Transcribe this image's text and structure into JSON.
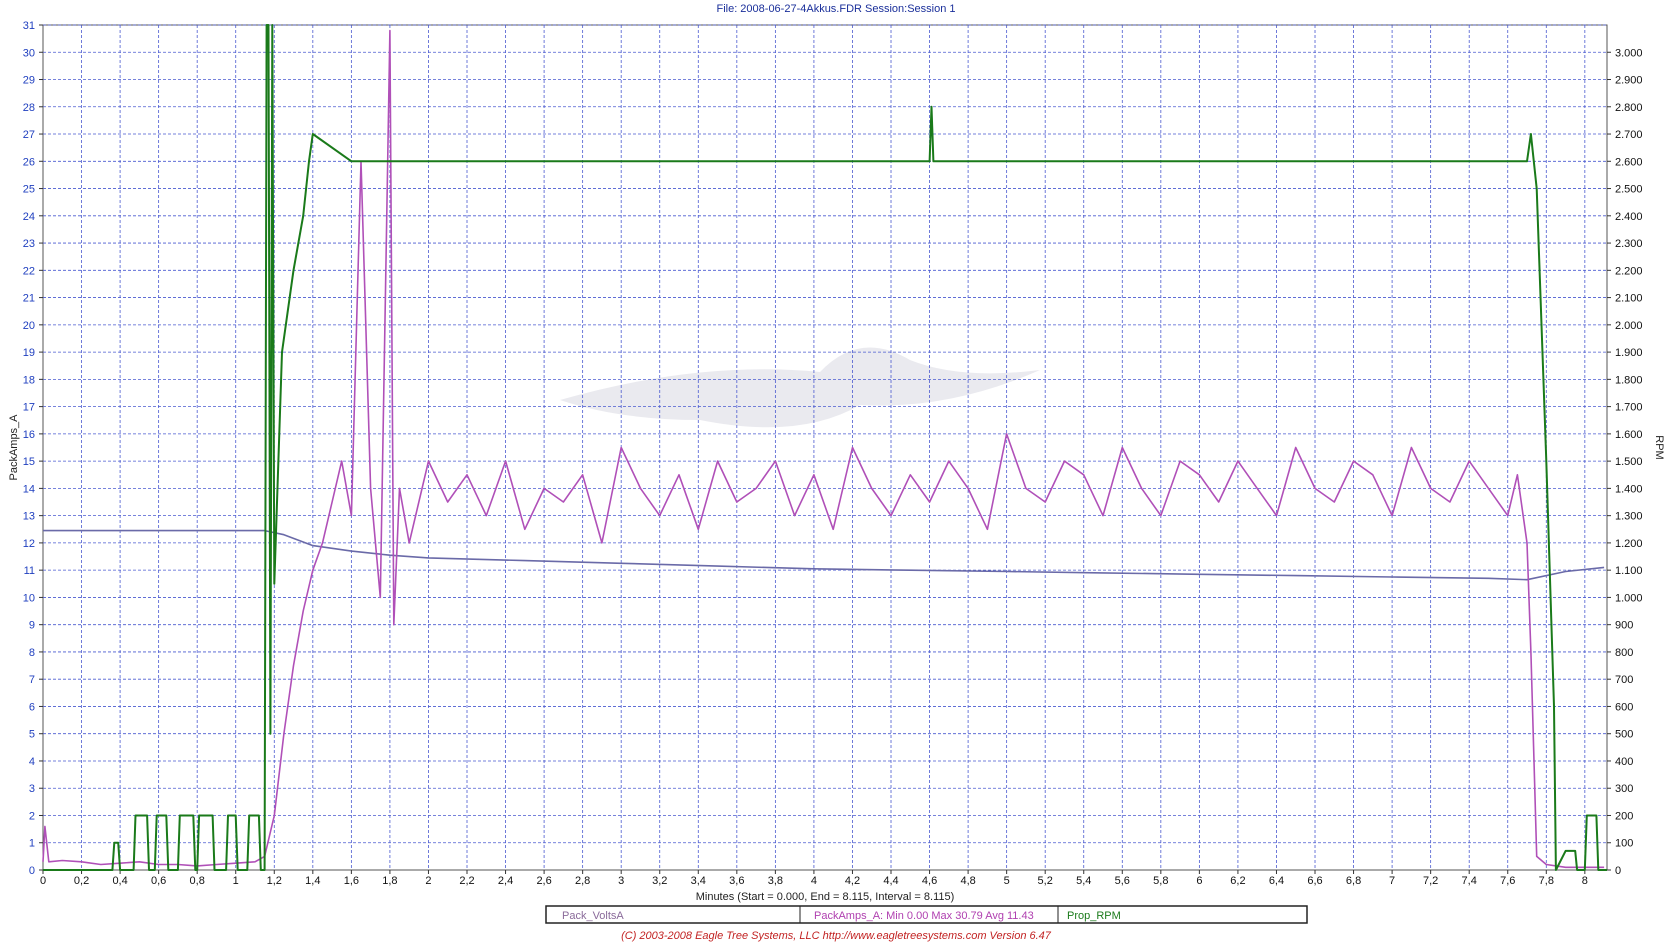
{
  "window": {
    "title": "File: 2008-06-27-4Akkus.FDR   Session:Session 1",
    "footer": "(C) 2003-2008 Eagle Tree Systems, LLC      http://www.eagletreesystems.com      Version 6.47"
  },
  "chart_data": {
    "type": "line",
    "title": "File: 2008-06-27-4Akkus.FDR   Session:Session 1",
    "xlabel": "Minutes (Start = 0.000,  End = 8.115,  Interval = 8.115)",
    "ylabel": "PackAmps_A",
    "ylabel_right": "RPM",
    "xlim": [
      0,
      8.115
    ],
    "ylim": [
      0,
      31
    ],
    "ylim_right": [
      0,
      3100
    ],
    "grid": true,
    "x_ticks": [
      "0",
      "0,2",
      "0,4",
      "0,6",
      "0,8",
      "1",
      "1,2",
      "1,4",
      "1,6",
      "1,8",
      "2",
      "2,2",
      "2,4",
      "2,6",
      "2,8",
      "3",
      "3,2",
      "3,4",
      "3,6",
      "3,8",
      "4",
      "4,2",
      "4,4",
      "4,6",
      "4,8",
      "5",
      "5,2",
      "5,4",
      "5,6",
      "5,8",
      "6",
      "6,2",
      "6,4",
      "6,6",
      "6,8",
      "7",
      "7,2",
      "7,4",
      "7,6",
      "7,8",
      "8"
    ],
    "y_ticks_left": [
      "0",
      "1",
      "2",
      "3",
      "4",
      "5",
      "6",
      "7",
      "8",
      "9",
      "10",
      "11",
      "12",
      "13",
      "14",
      "15",
      "16",
      "17",
      "18",
      "19",
      "20",
      "21",
      "22",
      "23",
      "24",
      "25",
      "26",
      "27",
      "28",
      "29",
      "30",
      "31"
    ],
    "y_ticks_right": [
      "0",
      "100",
      "200",
      "300",
      "400",
      "500",
      "600",
      "700",
      "800",
      "900",
      "1.000",
      "1.100",
      "1.200",
      "1.300",
      "1.400",
      "1.500",
      "1.600",
      "1.700",
      "1.800",
      "1.900",
      "2.000",
      "2.100",
      "2.200",
      "2.300",
      "2.400",
      "2.500",
      "2.600",
      "2.700",
      "2.800",
      "2.900",
      "3.000"
    ],
    "legend": [
      {
        "text": "Pack_VoltsA",
        "color": "#8a6a9a"
      },
      {
        "text": "PackAmps_A:  Min 0.00   Max 30.79   Avg 11.43",
        "color": "#b040b0"
      },
      {
        "text": "Prop_RPM",
        "color": "#1a7a1a"
      }
    ],
    "series": [
      {
        "name": "Pack_VoltsA",
        "axis": "left",
        "color": "#6a6aa8",
        "x": [
          0,
          0.5,
          1.0,
          1.15,
          1.25,
          1.4,
          1.6,
          1.8,
          2.0,
          2.5,
          3.0,
          3.5,
          4.0,
          4.5,
          5.0,
          5.5,
          6.0,
          6.5,
          7.0,
          7.5,
          7.7,
          7.9,
          8.1
        ],
        "values": [
          12.45,
          12.45,
          12.45,
          12.45,
          12.3,
          11.9,
          11.7,
          11.55,
          11.45,
          11.35,
          11.25,
          11.15,
          11.05,
          11.0,
          10.95,
          10.9,
          10.85,
          10.8,
          10.75,
          10.7,
          10.65,
          10.95,
          11.1
        ]
      },
      {
        "name": "PackAmps_A",
        "axis": "left",
        "color": "#b050b8",
        "x": [
          0,
          0.01,
          0.03,
          0.1,
          0.2,
          0.3,
          0.4,
          0.5,
          0.6,
          0.7,
          0.8,
          0.9,
          1.0,
          1.1,
          1.15,
          1.2,
          1.25,
          1.3,
          1.35,
          1.4,
          1.45,
          1.5,
          1.55,
          1.6,
          1.65,
          1.7,
          1.75,
          1.8,
          1.82,
          1.85,
          1.9,
          2.0,
          2.1,
          2.2,
          2.3,
          2.4,
          2.5,
          2.6,
          2.7,
          2.8,
          2.9,
          3.0,
          3.1,
          3.2,
          3.3,
          3.4,
          3.5,
          3.6,
          3.7,
          3.8,
          3.9,
          4.0,
          4.1,
          4.2,
          4.3,
          4.4,
          4.5,
          4.6,
          4.7,
          4.8,
          4.9,
          5.0,
          5.1,
          5.2,
          5.3,
          5.4,
          5.5,
          5.6,
          5.7,
          5.8,
          5.9,
          6.0,
          6.1,
          6.2,
          6.3,
          6.4,
          6.5,
          6.6,
          6.7,
          6.8,
          6.9,
          7.0,
          7.1,
          7.2,
          7.3,
          7.4,
          7.5,
          7.6,
          7.65,
          7.7,
          7.72,
          7.75,
          7.8,
          7.9,
          8.0,
          8.1
        ],
        "values": [
          0.3,
          1.6,
          0.3,
          0.35,
          0.3,
          0.2,
          0.25,
          0.3,
          0.2,
          0.2,
          0.15,
          0.2,
          0.25,
          0.3,
          0.5,
          2.0,
          5.0,
          7.5,
          9.5,
          11.0,
          12.0,
          13.5,
          15.0,
          13.0,
          26.0,
          14.0,
          10.0,
          30.8,
          9.0,
          14.0,
          12.0,
          15.0,
          13.5,
          14.5,
          13.0,
          15.0,
          12.5,
          14.0,
          13.5,
          14.5,
          12.0,
          15.5,
          14.0,
          13.0,
          14.5,
          12.5,
          15.0,
          13.5,
          14.0,
          15.0,
          13.0,
          14.5,
          12.5,
          15.5,
          14.0,
          13.0,
          14.5,
          13.5,
          15.0,
          14.0,
          12.5,
          16.0,
          14.0,
          13.5,
          15.0,
          14.5,
          13.0,
          15.5,
          14.0,
          13.0,
          15.0,
          14.5,
          13.5,
          15.0,
          14.0,
          13.0,
          15.5,
          14.0,
          13.5,
          15.0,
          14.5,
          13.0,
          15.5,
          14.0,
          13.5,
          15.0,
          14.0,
          13.0,
          14.5,
          12.0,
          8.0,
          0.5,
          0.2,
          0.1,
          0.1,
          0.1
        ]
      },
      {
        "name": "Prop_RPM",
        "axis": "right",
        "color": "#1a7a1a",
        "x": [
          0,
          0.36,
          0.37,
          0.39,
          0.4,
          0.47,
          0.48,
          0.54,
          0.55,
          0.58,
          0.59,
          0.64,
          0.65,
          0.7,
          0.71,
          0.78,
          0.79,
          0.8,
          0.81,
          0.88,
          0.89,
          0.95,
          0.96,
          1.0,
          1.01,
          1.06,
          1.07,
          1.12,
          1.13,
          1.15,
          1.16,
          1.17,
          1.18,
          1.19,
          1.2,
          1.24,
          1.3,
          1.35,
          1.38,
          1.4,
          1.6,
          1.8,
          2.0,
          2.5,
          3.0,
          3.5,
          4.0,
          4.5,
          4.6,
          4.61,
          4.62,
          5.0,
          5.5,
          6.0,
          6.5,
          7.0,
          7.5,
          7.65,
          7.7,
          7.72,
          7.75,
          7.8,
          7.84,
          7.85,
          7.9,
          7.95,
          7.96,
          8.0,
          8.01,
          8.06,
          8.07,
          8.115
        ],
        "values": [
          0,
          0,
          100,
          100,
          0,
          0,
          200,
          200,
          0,
          0,
          200,
          200,
          0,
          0,
          200,
          200,
          0,
          0,
          200,
          200,
          0,
          0,
          200,
          200,
          0,
          0,
          200,
          200,
          0,
          0,
          3100,
          3100,
          500,
          3100,
          1050,
          1900,
          2200,
          2400,
          2600,
          2700,
          2600,
          2600,
          2600,
          2600,
          2600,
          2600,
          2600,
          2600,
          2600,
          2800,
          2600,
          2600,
          2600,
          2600,
          2600,
          2600,
          2600,
          2600,
          2600,
          2700,
          2500,
          1500,
          600,
          0,
          70,
          70,
          0,
          0,
          200,
          200,
          0,
          0
        ]
      }
    ]
  }
}
